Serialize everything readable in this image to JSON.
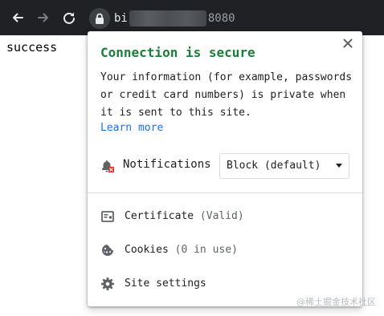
{
  "browser": {
    "url_host_prefix": "bi",
    "url_port": "8080"
  },
  "page": {
    "body_text": "success"
  },
  "site_info": {
    "title": "Connection is secure",
    "description": "Your information (for example, passwords or credit card numbers) is private when it is sent to this site.",
    "learn_more": "Learn more",
    "notifications_label": "Notifications",
    "notifications_value": "Block (default)",
    "certificate_label": "Certificate",
    "certificate_status": "(Valid)",
    "cookies_label": "Cookies",
    "cookies_status": "(0 in use)",
    "site_settings_label": "Site settings"
  },
  "watermark": "@稀土掘金技术社区",
  "colors": {
    "toolbar_bg": "#202124",
    "secure_green": "#188038",
    "link_blue": "#1a73e8",
    "blocked_red": "#d93025"
  },
  "icons": [
    "back-arrow-icon",
    "forward-arrow-icon",
    "reload-icon",
    "lock-icon",
    "close-icon",
    "notifications-blocked-icon",
    "certificate-icon",
    "cookies-icon",
    "settings-gear-icon"
  ]
}
